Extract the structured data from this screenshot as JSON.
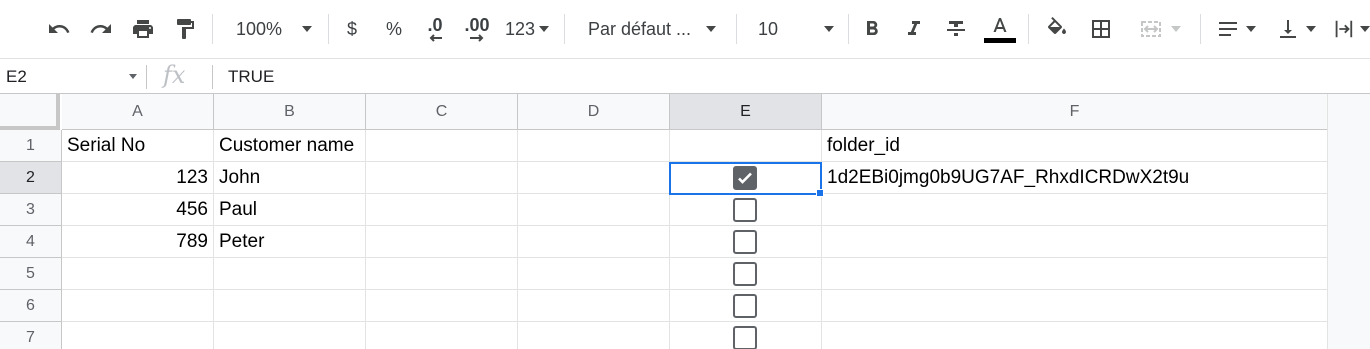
{
  "toolbar": {
    "zoom": "100%",
    "currency": "$",
    "percent": "%",
    "decimal_decrease": ".0",
    "decimal_increase": ".00",
    "number_format": "123",
    "font": "Par défaut ...",
    "font_size": "10",
    "text_color": "#000000"
  },
  "formula_bar": {
    "cell_ref": "E2",
    "fx": "fx",
    "value": "TRUE"
  },
  "grid": {
    "columns": [
      "A",
      "B",
      "C",
      "D",
      "E",
      "F"
    ],
    "selected_column": "E",
    "rows": [
      "1",
      "2",
      "3",
      "4",
      "5",
      "6",
      "7"
    ],
    "selected_row": "2",
    "cells": {
      "A1": "Serial No",
      "B1": "Customer name",
      "F1": "folder_id",
      "A2": "123",
      "B2": "John",
      "F2": "1d2EBi0jmg0b9UG7AF_RhxdICRDwX2t9u",
      "A3": "456",
      "B3": "Paul",
      "A4": "789",
      "B4": "Peter"
    },
    "checkboxes": {
      "E2": true,
      "E3": false,
      "E4": false,
      "E5": false,
      "E6": false,
      "E7": false
    },
    "selection_color": "#1a73e8"
  }
}
